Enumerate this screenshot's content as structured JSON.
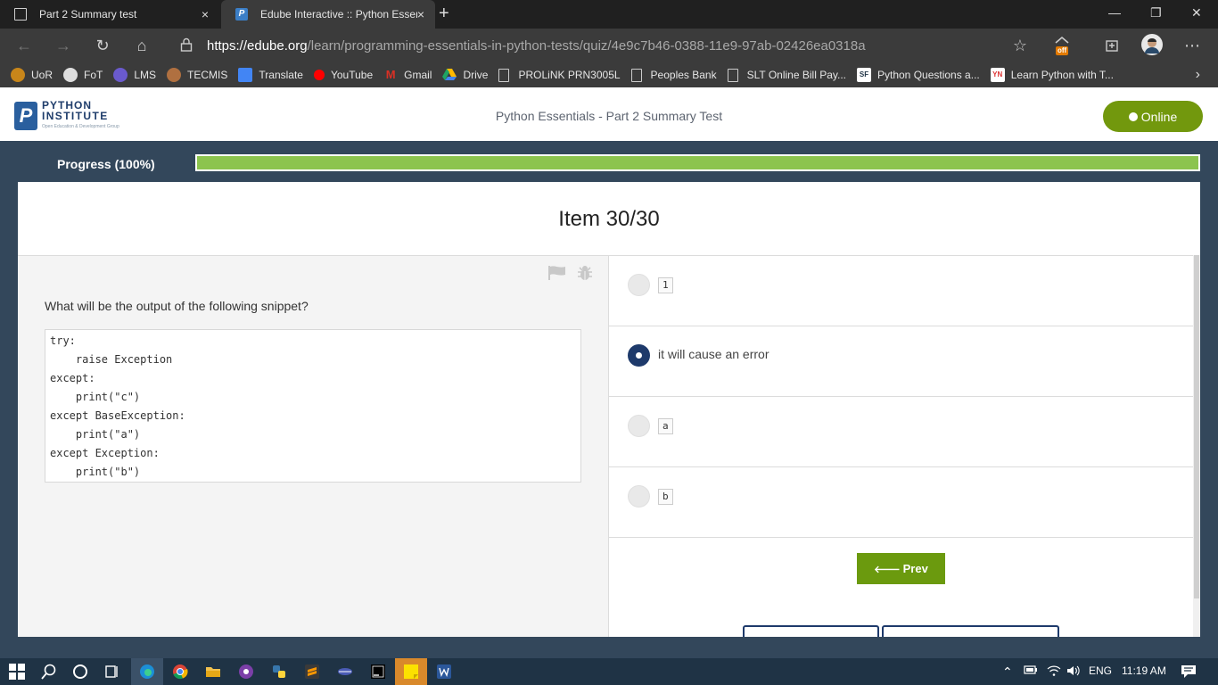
{
  "browser": {
    "tabs": [
      {
        "title": "Part 2 Summary test",
        "close": "×"
      },
      {
        "title": "Edube Interactive :: Python Essen",
        "close": "×"
      }
    ],
    "new_tab": "+",
    "window_controls": {
      "minimize": "—",
      "restore": "❐",
      "close": "✕"
    },
    "address": {
      "host": "https://edube.org",
      "path": "/learn/programming-essentials-in-python-tests/quiz/4e9c7b46-0388-11e9-97ab-02426ea0318a"
    },
    "extension_badge": "off",
    "bookmarks": [
      {
        "label": "UoR",
        "icon": "uor-icon",
        "color": "#c8861a"
      },
      {
        "label": "FoT",
        "icon": "fot-icon",
        "color": "#dddddd"
      },
      {
        "label": "LMS",
        "icon": "lms-icon",
        "color": "#6a5acd"
      },
      {
        "label": "TECMIS",
        "icon": "tecmis-icon",
        "color": "#b07040"
      },
      {
        "label": "Translate",
        "icon": "translate-icon",
        "color": "#4285f4"
      },
      {
        "label": "YouTube",
        "icon": "youtube-icon",
        "color": "#ff0000"
      },
      {
        "label": "Gmail",
        "icon": "gmail-icon",
        "color": "#d93025"
      },
      {
        "label": "Drive",
        "icon": "drive-icon",
        "color": "#1fa463"
      },
      {
        "label": "PROLiNK PRN3005L",
        "icon": "page-icon",
        "color": "#cccccc"
      },
      {
        "label": "Peoples Bank",
        "icon": "page-icon",
        "color": "#cccccc"
      },
      {
        "label": "SLT Online Bill Pay...",
        "icon": "page-icon",
        "color": "#cccccc"
      },
      {
        "label": "Python Questions a...",
        "icon": "sf-icon",
        "color": "#ffffff"
      },
      {
        "label": "Learn Python with T...",
        "icon": "learn-icon",
        "color": "#ffffff"
      }
    ],
    "bookmarks_more": "›"
  },
  "header": {
    "logo_line1": "PYTHON",
    "logo_line2": "INSTITUTE",
    "logo_line3": "Open Education & Development Group",
    "logo_mark": "P",
    "title": "Python Essentials - Part 2 Summary Test",
    "status_button": "Online"
  },
  "progress": {
    "label": "Progress (100%)",
    "value": 1.0
  },
  "quiz": {
    "item_title": "Item 30/30",
    "question": "What will be the output of the following snippet?",
    "code_lines": [
      "try:",
      "    raise Exception",
      "except:",
      "    print(\"c\")",
      "except BaseException:",
      "    print(\"a\")",
      "except Exception:",
      "    print(\"b\")"
    ],
    "options": [
      {
        "text": "1",
        "style": "code",
        "selected": false
      },
      {
        "text": "it will cause an error",
        "style": "text",
        "selected": true
      },
      {
        "text": "a",
        "style": "code",
        "selected": false
      },
      {
        "text": "b",
        "style": "code",
        "selected": false
      }
    ],
    "prev_label": "Prev",
    "prev_arrow": "🡐"
  },
  "taskbar": {
    "language": "ENG",
    "time": "11:19 AM"
  },
  "colors": {
    "accent_green": "#72980d",
    "progress_fill": "#8cc44e",
    "band": "#33475b",
    "radio_selected": "#1e3a6b"
  }
}
